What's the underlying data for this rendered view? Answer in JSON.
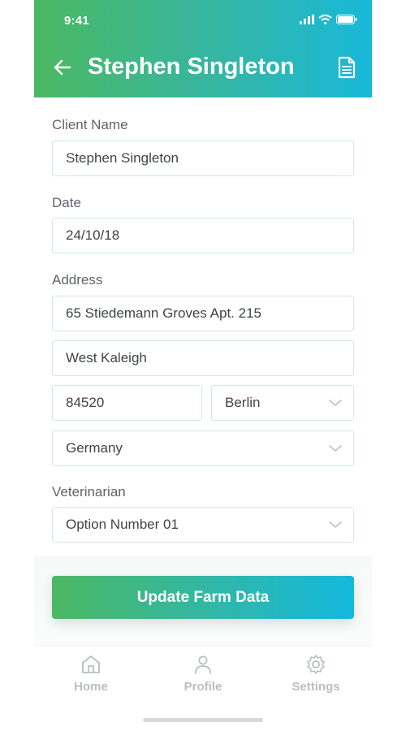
{
  "status_bar": {
    "time": "9:41"
  },
  "header": {
    "title": "Stephen Singleton"
  },
  "form": {
    "client_name_label": "Client Name",
    "client_name_value": "Stephen Singleton",
    "date_label": "Date",
    "date_value": "24/10/18",
    "address_label": "Address",
    "address_line1": "65 Stiedemann Groves Apt. 215",
    "address_line2": "West Kaleigh",
    "postal_code": "84520",
    "city": "Berlin",
    "country": "Germany",
    "veterinarian_label": "Veterinarian",
    "veterinarian_value": "Option Number 01"
  },
  "actions": {
    "update_label": "Update Farm Data"
  },
  "tabs": [
    {
      "label": "Home",
      "icon": "home-icon"
    },
    {
      "label": "Profile",
      "icon": "user-icon"
    },
    {
      "label": "Settings",
      "icon": "gear-icon"
    }
  ],
  "colors": {
    "gradient_start": "#4cb862",
    "gradient_end": "#18b8da",
    "field_border": "#cfe9e8",
    "tab_inactive": "#b9bec1"
  }
}
